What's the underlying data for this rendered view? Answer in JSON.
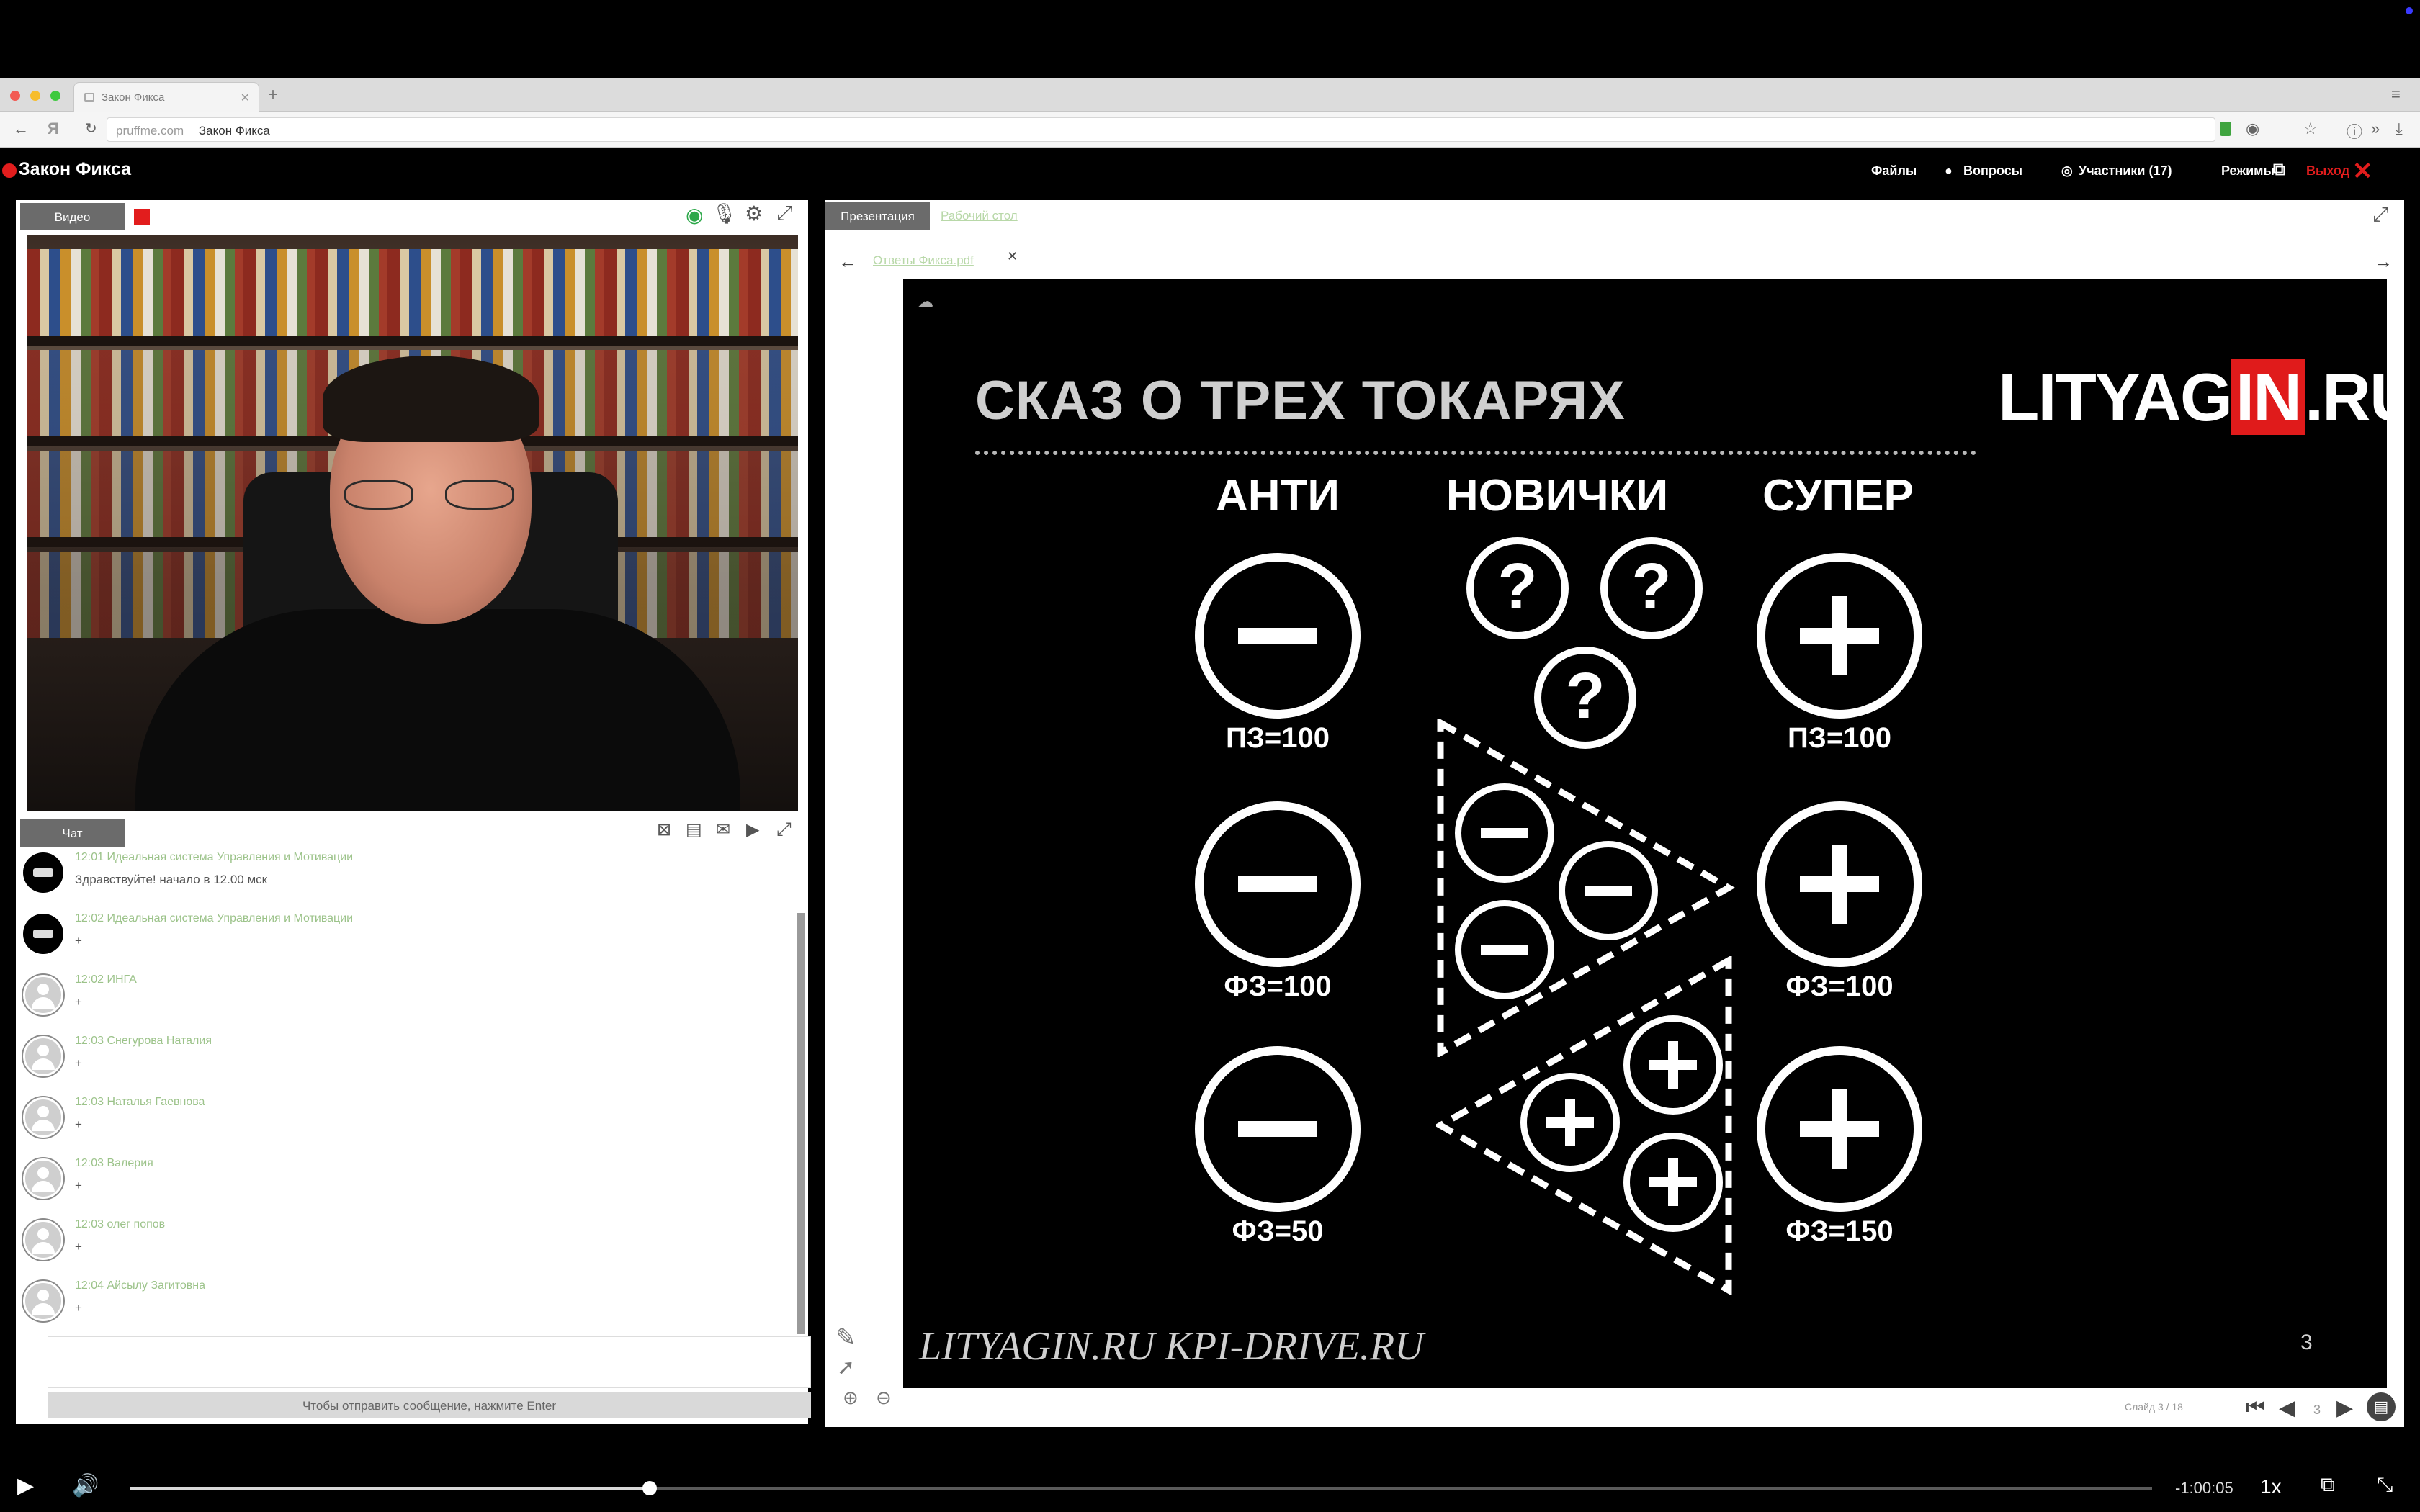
{
  "browser": {
    "tab_title": "Закон Фикса",
    "address_domain": "pruffme.com",
    "address_title": "Закон Фикса"
  },
  "app": {
    "brand": "Закон Фикса",
    "nav": {
      "files": "Файлы",
      "questions": "Вопросы",
      "participants": "Участники (17)",
      "modes": "Режимы",
      "exit": "Выход"
    }
  },
  "video_panel": {
    "tab": "Видео"
  },
  "chat": {
    "tab": "Чат",
    "messages": [
      {
        "meta": "12:01 Идеальная система Управления и Мотивации",
        "text": "Здравствуйте! начало в 12.00 мск",
        "avatar": "logo"
      },
      {
        "meta": "12:02 Идеальная система Управления и Мотивации",
        "text": "+",
        "avatar": "logo"
      },
      {
        "meta": "12:02 ИНГА",
        "text": "+",
        "avatar": "user"
      },
      {
        "meta": "12:03 Снегурова Наталия",
        "text": "+",
        "avatar": "user"
      },
      {
        "meta": "12:03 Наталья Гаевнова",
        "text": "+",
        "avatar": "user"
      },
      {
        "meta": "12:03 Валерия",
        "text": "+",
        "avatar": "user"
      },
      {
        "meta": "12:03 олег попов",
        "text": "+",
        "avatar": "user"
      },
      {
        "meta": "12:04 Айсылу Загитовна",
        "text": "+",
        "avatar": "user"
      }
    ],
    "send_hint": "Чтобы отправить сообщение, нажмите Enter"
  },
  "presentation_panel": {
    "tab_presentation": "Презентация",
    "tab_desktop": "Рабочий стол",
    "file_name": "Ответы Фикса.pdf"
  },
  "slide": {
    "title": "СКАЗ О ТРЕХ ТОКАРЯХ",
    "logo_left": "LITYAG",
    "logo_mid": "IN",
    "logo_right": ".RU",
    "columns": [
      "АНТИ",
      "НОВИЧКИ",
      "СУПЕР"
    ],
    "anti_labels": [
      "ПЗ=100",
      "ФЗ=100",
      "ФЗ=50"
    ],
    "super_labels": [
      "ПЗ=100",
      "ФЗ=100",
      "ФЗ=150"
    ],
    "question_mark": "?",
    "footer": "LITYAGIN.RU  KPI-DRIVE.RU",
    "page": "3"
  },
  "pager": {
    "label": "Слайд 3 / 18",
    "current": "3"
  },
  "player": {
    "time_remaining": "-1:00:05",
    "speed": "1x",
    "progress_fraction": 0.257
  },
  "colors": {
    "accent_red": "#e21d1d",
    "chat_meta": "#9cc38a"
  }
}
